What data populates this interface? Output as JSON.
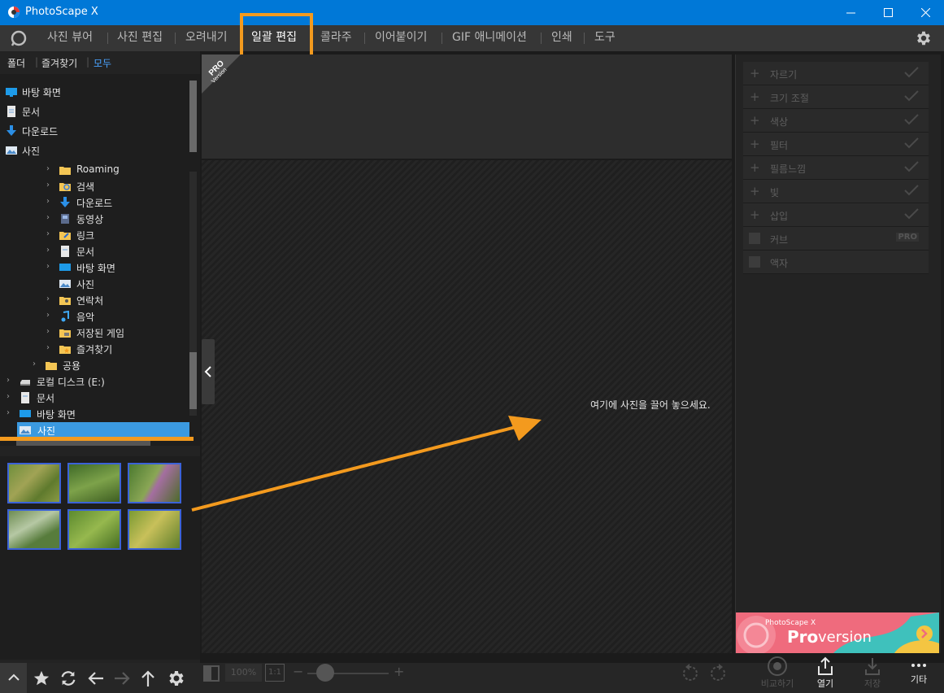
{
  "app": {
    "title": "PhotoScape X",
    "accent": "#0078d7",
    "highlight": "#f39a1e"
  },
  "window": {
    "minimize_icon": "minimize-icon",
    "maximize_icon": "maximize-icon",
    "close_icon": "close-icon"
  },
  "menu": {
    "tabs": [
      "사진 뷰어",
      "사진 편집",
      "오려내기",
      "일괄 편집",
      "콜라주",
      "이어붙이기",
      "GIF 애니메이션",
      "인쇄",
      "도구"
    ],
    "active": "일괄 편집"
  },
  "folder_tabs": {
    "folder": "폴더",
    "favorites": "즐겨찾기",
    "all": "모두"
  },
  "quick_access": [
    "바탕 화면",
    "문서",
    "다운로드",
    "사진"
  ],
  "tree": [
    {
      "label": "Roaming",
      "level": 3
    },
    {
      "label": "검색",
      "level": 3
    },
    {
      "label": "다운로드",
      "level": 3
    },
    {
      "label": "동영상",
      "level": 3
    },
    {
      "label": "링크",
      "level": 3
    },
    {
      "label": "문서",
      "level": 3
    },
    {
      "label": "바탕 화면",
      "level": 3
    },
    {
      "label": "사진",
      "level": 3
    },
    {
      "label": "연락처",
      "level": 3
    },
    {
      "label": "음악",
      "level": 3
    },
    {
      "label": "저장된 게임",
      "level": 3
    },
    {
      "label": "즐겨찾기",
      "level": 3
    },
    {
      "label": "공용",
      "level": 2
    },
    {
      "label": "로컬 디스크 (E:)",
      "level": 1
    },
    {
      "label": "문서",
      "level": 1
    },
    {
      "label": "바탕 화면",
      "level": 1
    },
    {
      "label": "사진",
      "level": 1,
      "selected": true
    }
  ],
  "pro_badge": {
    "line1": "PRO",
    "line2": "Version"
  },
  "drop_hint": "여기에 사진을 끌어 놓으세요.",
  "operations": [
    {
      "label": "자르기",
      "type": "plus"
    },
    {
      "label": "크기 조절",
      "type": "plus"
    },
    {
      "label": "색상",
      "type": "plus"
    },
    {
      "label": "필터",
      "type": "plus"
    },
    {
      "label": "필름느낌",
      "type": "plus"
    },
    {
      "label": "빛",
      "type": "plus"
    },
    {
      "label": "삽입",
      "type": "plus"
    },
    {
      "label": "커브",
      "type": "check",
      "pro": "PRO"
    },
    {
      "label": "액자",
      "type": "check"
    }
  ],
  "promo": {
    "small": "PhotoScape X",
    "big_pro": "Pro",
    "big_version": " version"
  },
  "zoom": {
    "value": "100%",
    "one_to_one": "1:1",
    "minus": "−",
    "plus": "+"
  },
  "bottom_actions": {
    "compare": "비교하기",
    "open": "열기",
    "save": "저장",
    "more": "기타"
  }
}
